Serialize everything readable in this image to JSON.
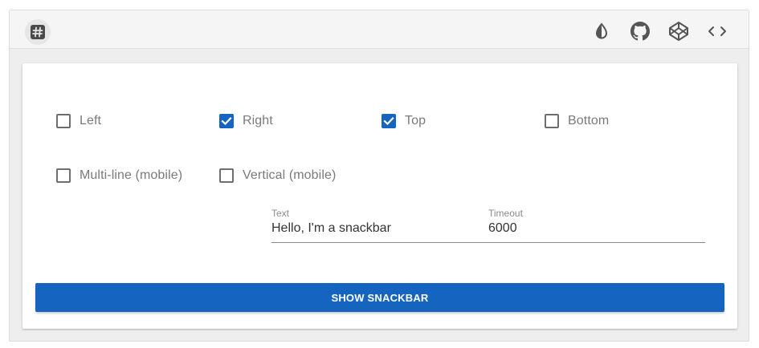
{
  "toolbar": {
    "left_icon": "hash-icon",
    "right_icons": [
      "contrast-icon",
      "github-icon",
      "codepen-icon",
      "code-icon"
    ]
  },
  "options": {
    "left": {
      "label": "Left",
      "checked": false
    },
    "right": {
      "label": "Right",
      "checked": true
    },
    "top": {
      "label": "Top",
      "checked": true
    },
    "bottom": {
      "label": "Bottom",
      "checked": false
    },
    "multiline": {
      "label": "Multi-line (mobile)",
      "checked": false
    },
    "vertical": {
      "label": "Vertical (mobile)",
      "checked": false
    }
  },
  "fields": {
    "text": {
      "label": "Text",
      "value": "Hello, I'm a snackbar"
    },
    "timeout": {
      "label": "Timeout",
      "value": "6000"
    }
  },
  "action": {
    "label": "SHOW SNACKBAR"
  },
  "colors": {
    "accent": "#1565c0",
    "toolbar_bg": "#f5f5f5"
  }
}
